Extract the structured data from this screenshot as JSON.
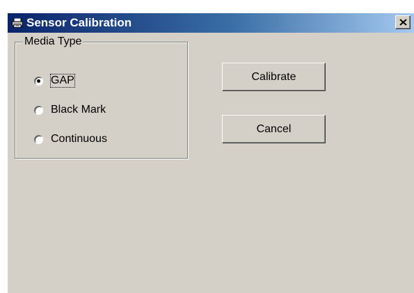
{
  "window": {
    "title": "Sensor Calibration",
    "title_icon": "printer-icon",
    "close_icon": "close-icon"
  },
  "media_type": {
    "legend": "Media Type",
    "options": [
      {
        "label": "GAP",
        "selected": true,
        "focused": true
      },
      {
        "label": "Black Mark",
        "selected": false,
        "focused": false
      },
      {
        "label": "Continuous",
        "selected": false,
        "focused": false
      }
    ]
  },
  "buttons": {
    "calibrate_label": "Calibrate",
    "cancel_label": "Cancel"
  },
  "colors": {
    "dialog_face": "#d4d0c8",
    "titlebar_start": "#0a246a",
    "titlebar_end": "#a6caf0",
    "title_text": "#ffffff"
  }
}
